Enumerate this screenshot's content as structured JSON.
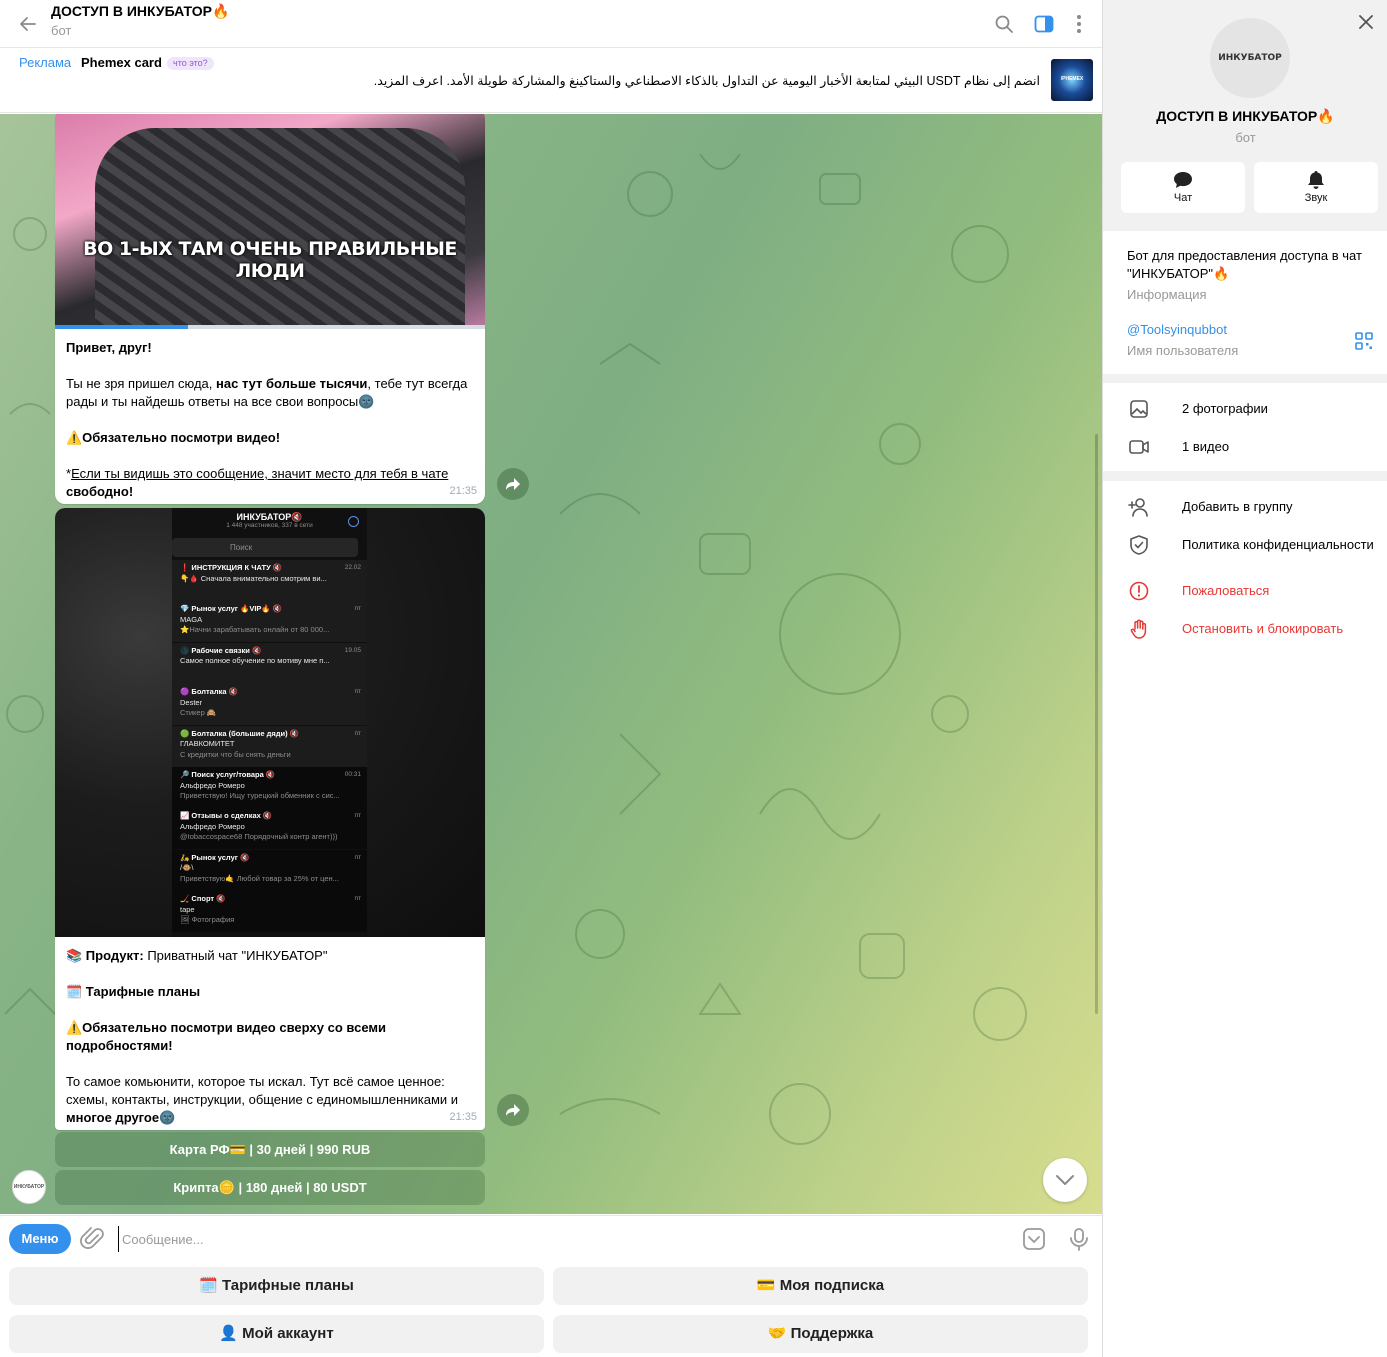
{
  "header": {
    "title": "ДОСТУП В ИНКУБАТОР🔥",
    "subtitle": "бот",
    "icons": [
      "back-arrow-icon",
      "search-icon",
      "sidebar-toggle-icon",
      "more-vertical-icon"
    ]
  },
  "ad": {
    "label": "Реклама",
    "sponsor": "Phemex card",
    "what_is_it": "что это?",
    "text": "انضم إلى نظام USDT البيئي لمتابعة الأخبار اليومية عن التداول بالذكاء الاصطناعي والستاكينغ والمشاركة طويلة الأمد. اعرف المزيد.",
    "thumb_text": "/PHEMEX"
  },
  "messages": [
    {
      "video_caption": "ВО 1-ЫХ ТАМ ОЧЕНЬ ПРАВИЛЬНЫЕ ЛЮДИ",
      "video_progress": 0.31,
      "greeting": "Привет, друг!",
      "p1_start": "Ты не зря пришел сюда, ",
      "p1_bold": "нас тут больше тысячи",
      "p1_end": ", тебе тут всегда рады и ты найдешь ответы на все свои вопросы🌚",
      "warning": "⚠️Обязательно посмотри видео!",
      "note_prefix": "*",
      "note_link": "Если ты видишь это сообщение, значит место для тебя в чате",
      "note_bold": "свободно!",
      "time": "21:35"
    },
    {
      "screenshot": {
        "title": "ИНКУБАТОР🔇",
        "subtitle": "1 448 участников, 337 в сети",
        "search": "Поиск",
        "rows": [
          {
            "title": "❗ ИНСТРУКЦИЯ К ЧАТУ 🔇",
            "line2": "👇🩸 Сначала внимательно смотрим ви...",
            "line3": "",
            "time": "22.02"
          },
          {
            "title": "💎 Рынок услуг 🔥VIP🔥 🔇",
            "line2": "MAGA",
            "line3": "⭐Начни зарабатывать онлайн от 80 000...",
            "time": "пт"
          },
          {
            "title": "🌑 Рабочие связки 🔇",
            "line2": "Самое полное обучение по мотиву мне п...",
            "line3": "",
            "time": "19.05"
          },
          {
            "title": "🟣 Болталка 🔇",
            "line2": "Dester",
            "line3": "Стикер 🙈",
            "time": "пт"
          },
          {
            "title": "🟢 Болталка (большие дяди) 🔇",
            "line2": "ГЛАВКОМИТЕТ",
            "line3": "С кредитки что бы снять деньги",
            "time": "пт"
          },
          {
            "title": "🔎 Поиск услуг/товара 🔇",
            "line2": "Альфредо Ромеро",
            "line3": "Приветствую! Ищу турецкий обменник с сис...",
            "time": "00:31"
          },
          {
            "title": "📈 Отзывы о сделках 🔇",
            "line2": "Альфредо Ромеро",
            "line3": "@tobaccospace68 Порядочный контр агент)))",
            "time": "пт"
          },
          {
            "title": "🛵 Рынок услуг 🔇",
            "line2": "/🐵\\",
            "line3": "Приветствую🤙 Любой товар за 25% от цен...",
            "time": "пт"
          },
          {
            "title": "🏒 Спорт 🔇",
            "line2": "tape",
            "line3": "🖼 Фотография",
            "time": "пт"
          }
        ]
      },
      "product_label": "📚 Продукт:",
      "product_value": " Приватный чат \"ИНКУБАТОР\"",
      "plans": "🗓️ Тарифные планы",
      "warning": "⚠️Обязательно посмотри видео сверху со всеми подробностями!",
      "p_start": "То самое комьюнити, которое ты искал. Тут всё самое ценное: схемы, контакты, инструкции, общение с единомышленниками и ",
      "p_bold": "многое другое",
      "p_end": "🌚",
      "time": "21:35"
    }
  ],
  "inline_buttons": [
    "Карта РФ💳 | 30 дней | 990 RUB",
    "Крипта🪙 | 180 дней | 80 USDT"
  ],
  "bot_avatar_text": "ИНКУБАТОР",
  "composer": {
    "menu": "Меню",
    "placeholder": "Сообщение..."
  },
  "reply_keyboard": [
    "🗓️ Тарифные планы",
    "💳 Моя подписка",
    "👤 Мой аккаунт",
    "🤝 Поддержка"
  ],
  "info": {
    "avatar_text": "ИНКУБАТОР",
    "name": "ДОСТУП В ИНКУБАТОР🔥",
    "subtitle": "бот",
    "chat_label": "Чат",
    "sound_label": "Звук",
    "about": "Бот для предоставления доступа в чат \"ИНКУБАТОР\"🔥",
    "about_label": "Информация",
    "username": "@Toolsyinqubbot",
    "username_label": "Имя пользователя",
    "photos": "2 фотографии",
    "videos": "1 видео",
    "add_to_group": "Добавить в группу",
    "privacy": "Политика конфиденциальности",
    "report": "Пожаловаться",
    "block": "Остановить и блокировать"
  },
  "colors": {
    "accent": "#3390ec",
    "danger": "#e53935",
    "muted": "#999999"
  }
}
